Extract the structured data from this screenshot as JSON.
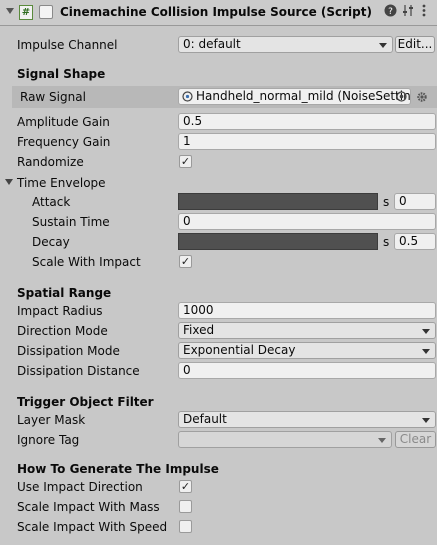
{
  "header": {
    "title": "Cinemachine Collision Impulse Source (Script)",
    "script_icon": "#",
    "icons": [
      "help-icon",
      "presets-icon",
      "more-menu-icon"
    ]
  },
  "impulse_channel": {
    "label": "Impulse Channel",
    "value": "0: default",
    "edit_label": "Edit..."
  },
  "signal_shape": {
    "heading": "Signal Shape",
    "raw_signal": {
      "label": "Raw Signal",
      "value": "Handheld_normal_mild (NoiseSettings)"
    },
    "amplitude_gain": {
      "label": "Amplitude Gain",
      "value": "0.5"
    },
    "frequency_gain": {
      "label": "Frequency Gain",
      "value": "1"
    },
    "randomize": {
      "label": "Randomize",
      "checked": true
    },
    "time_envelope": {
      "label": "Time Envelope",
      "attack": {
        "label": "Attack",
        "unit": "s",
        "value": "0"
      },
      "sustain_time": {
        "label": "Sustain Time",
        "value": "0"
      },
      "decay": {
        "label": "Decay",
        "unit": "s",
        "value": "0.5"
      },
      "scale_with_impact": {
        "label": "Scale With Impact",
        "checked": true
      }
    }
  },
  "spatial_range": {
    "heading": "Spatial Range",
    "impact_radius": {
      "label": "Impact Radius",
      "value": "1000"
    },
    "direction_mode": {
      "label": "Direction Mode",
      "value": "Fixed"
    },
    "dissipation_mode": {
      "label": "Dissipation Mode",
      "value": "Exponential Decay"
    },
    "dissipation_distance": {
      "label": "Dissipation Distance",
      "value": "0"
    }
  },
  "trigger_filter": {
    "heading": "Trigger Object Filter",
    "layer_mask": {
      "label": "Layer Mask",
      "value": "Default"
    },
    "ignore_tag": {
      "label": "Ignore Tag",
      "value": "",
      "clear_label": "Clear"
    }
  },
  "generate_impulse": {
    "heading": "How To Generate The Impulse",
    "use_impact_direction": {
      "label": "Use Impact Direction",
      "checked": true
    },
    "scale_with_mass": {
      "label": "Scale Impact With Mass",
      "checked": false
    },
    "scale_with_speed": {
      "label": "Scale Impact With Speed",
      "checked": false
    }
  },
  "check_glyph": "✓",
  "colors": {
    "background": "#c8c8c8",
    "slider": "#505050",
    "raw_row": "#b8b8b8"
  }
}
